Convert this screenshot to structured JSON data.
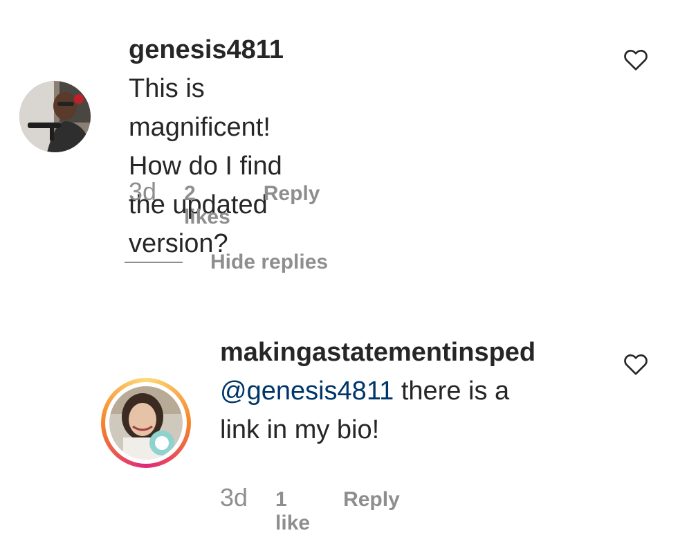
{
  "comment": {
    "username": "genesis4811",
    "text_line1": "This is magnificent!",
    "text_line2": "How do I find the updated",
    "text_line3": "version?",
    "time": "3d",
    "likes": "2 likes",
    "reply_label": "Reply",
    "like_icon": "heart-outline-icon"
  },
  "hide_replies_label": "Hide replies",
  "reply": {
    "username": "makingastatementinsped",
    "mention": "@genesis4811",
    "text_line1_rest": " there is a",
    "text_line2": "link in my bio!",
    "time": "3d",
    "likes": "1 like",
    "reply_label": "Reply",
    "like_icon": "heart-outline-icon",
    "story_ring_colors": [
      "#f58529",
      "#dd2a7b",
      "#feda77"
    ]
  }
}
